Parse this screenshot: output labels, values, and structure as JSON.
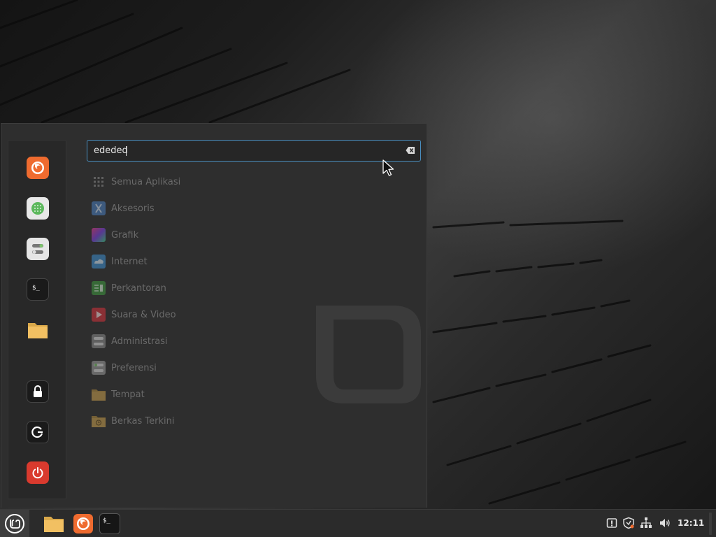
{
  "search": {
    "value": "ededed",
    "placeholder": ""
  },
  "favorites": [
    {
      "name": "firefox",
      "icon": "firefox-icon"
    },
    {
      "name": "software-manager",
      "icon": "software-manager-icon"
    },
    {
      "name": "system-settings",
      "icon": "settings-icon"
    },
    {
      "name": "terminal",
      "icon": "terminal-icon"
    },
    {
      "name": "files",
      "icon": "folder-icon"
    },
    {
      "name": "lock-screen",
      "icon": "lock-icon"
    },
    {
      "name": "logout",
      "icon": "logout-icon"
    },
    {
      "name": "shutdown",
      "icon": "power-icon"
    }
  ],
  "categories": [
    {
      "label": "Semua Aplikasi",
      "icon": "grid-icon"
    },
    {
      "label": "Aksesoris",
      "icon": "accessories-icon"
    },
    {
      "label": "Grafik",
      "icon": "graphics-icon"
    },
    {
      "label": "Internet",
      "icon": "internet-icon"
    },
    {
      "label": "Perkantoran",
      "icon": "office-icon"
    },
    {
      "label": "Suara & Video",
      "icon": "multimedia-icon"
    },
    {
      "label": "Administrasi",
      "icon": "administration-icon"
    },
    {
      "label": "Preferensi",
      "icon": "preferences-icon"
    },
    {
      "label": "Tempat",
      "icon": "places-folder-icon"
    },
    {
      "label": "Berkas Terkini",
      "icon": "recent-files-icon"
    }
  ],
  "taskbar": {
    "launchers": [
      "folder-icon",
      "firefox-icon",
      "terminal-icon"
    ],
    "tray": [
      "update-manager-icon",
      "security-shield-icon",
      "network-icon",
      "volume-icon"
    ],
    "clock": "12:11"
  },
  "colors": {
    "accent": "#4a90c2",
    "firefox": "#ef6b2f",
    "power": "#d93a2e",
    "folder": "#f2c062"
  }
}
